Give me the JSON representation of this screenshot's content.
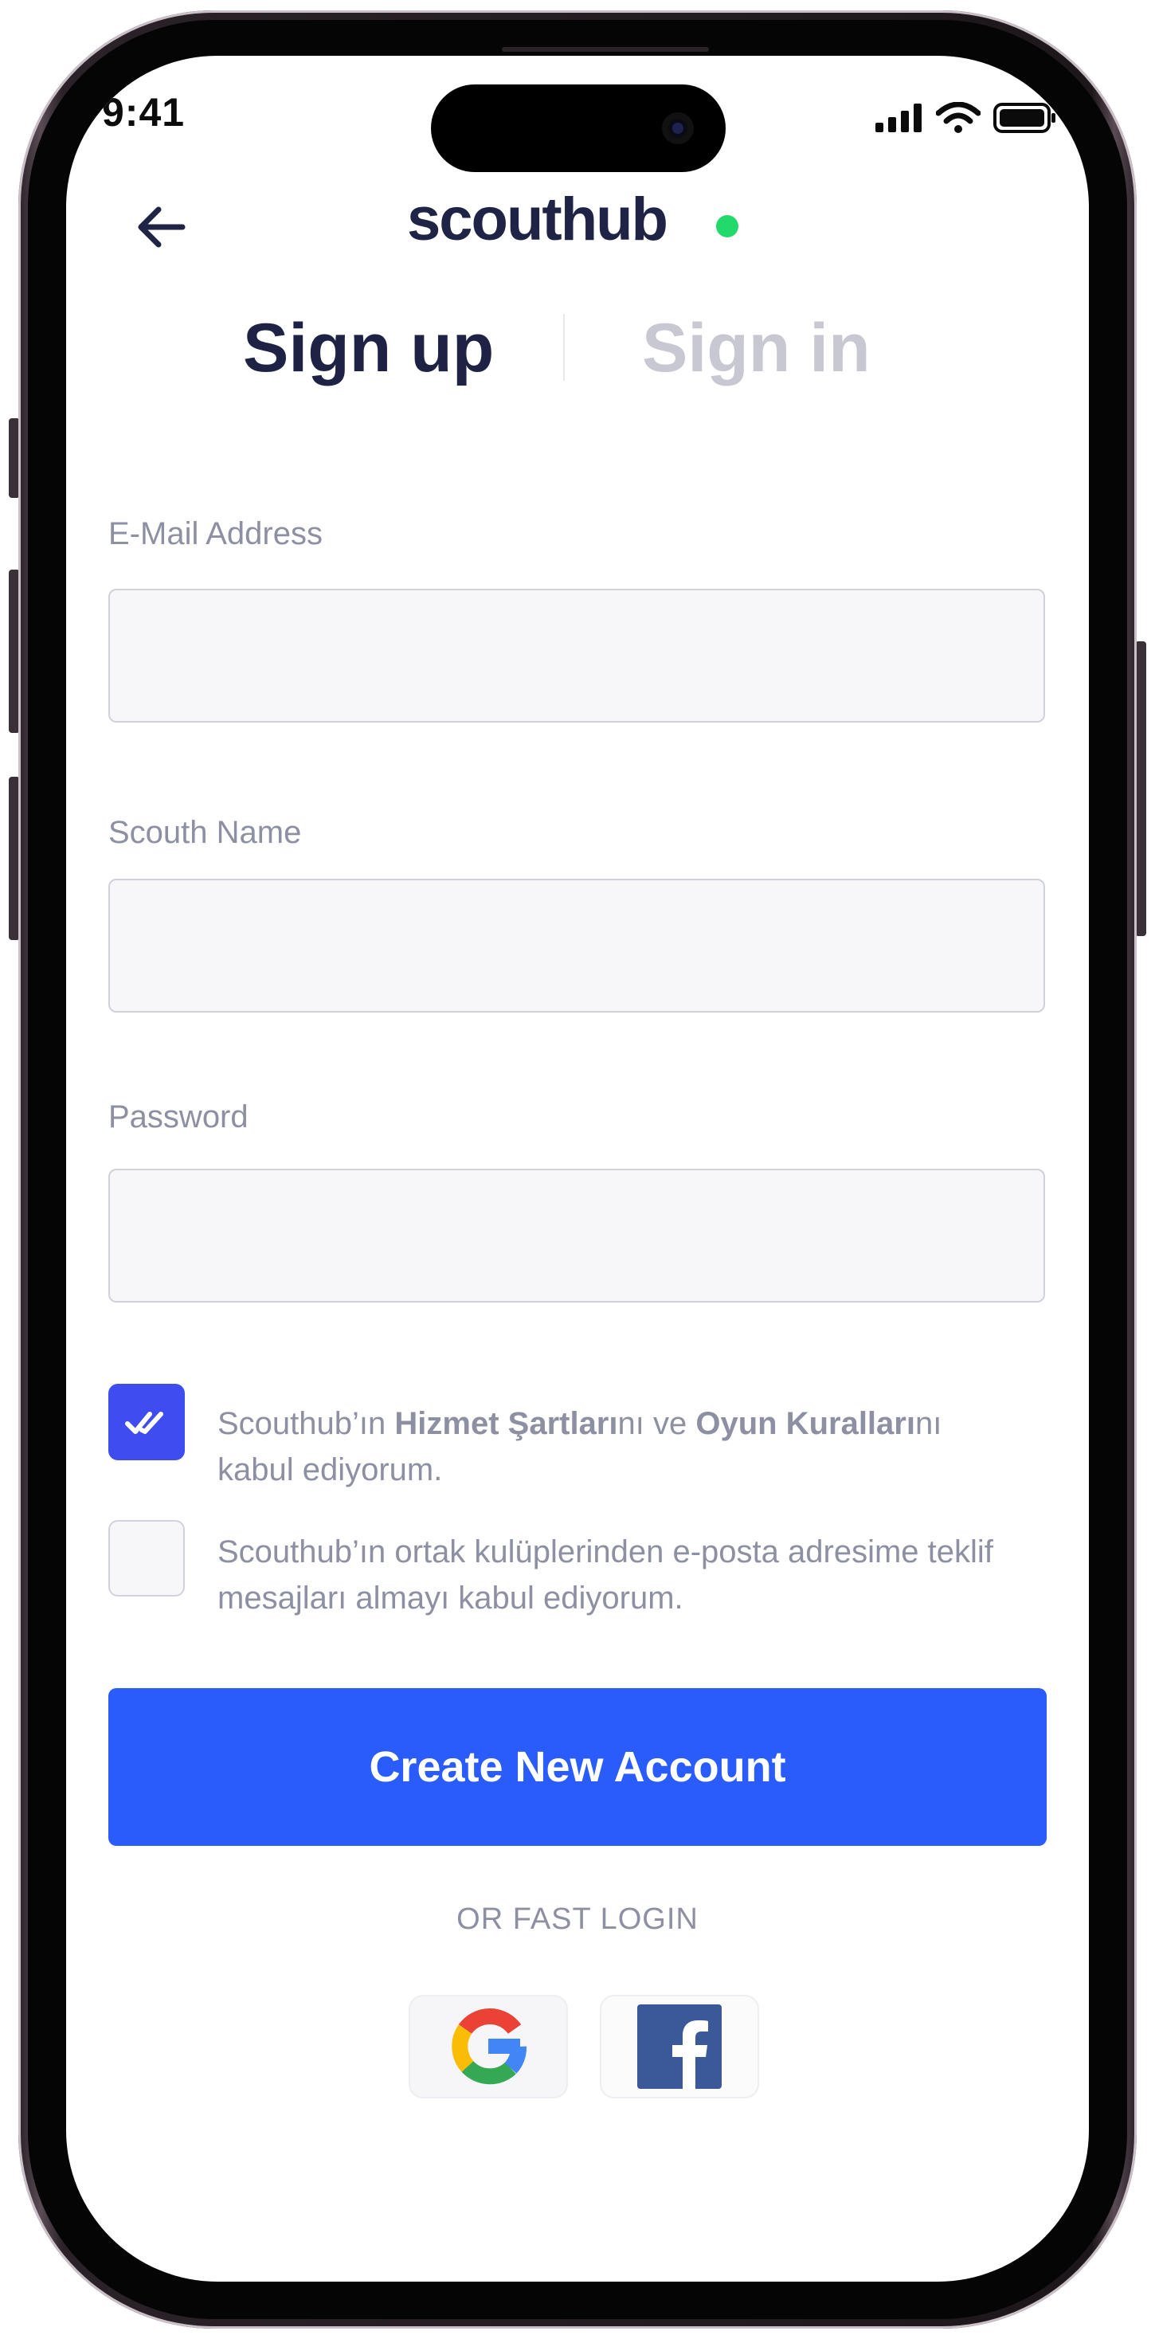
{
  "status_bar": {
    "time": "9:41"
  },
  "header": {
    "back_icon": "arrow-left-icon",
    "logo_text": "scouthub",
    "logo_dot_color": "#22d96b"
  },
  "tabs": [
    {
      "label": "Sign up",
      "active": true
    },
    {
      "label": "Sign in",
      "active": false
    }
  ],
  "form": {
    "email": {
      "label": "E-Mail Address",
      "value": ""
    },
    "scouth_name": {
      "label": "Scouth Name",
      "value": ""
    },
    "password": {
      "label": "Password",
      "value": ""
    }
  },
  "consents": [
    {
      "checked": true,
      "parts": [
        "Scouthub’ın ",
        "Hizmet Şartları",
        "nı ve ",
        "Oyun Kuralları",
        "nı kabul ediyorum."
      ]
    },
    {
      "checked": false,
      "text": "Scouthub’ın ortak kulüplerinden e-posta adresime teklif mesajları almayı kabul ediyorum."
    }
  ],
  "cta": {
    "label": "Create New Account",
    "color": "#2a5cfb"
  },
  "fast_login": {
    "label": "OR FAST LOGIN",
    "providers": [
      {
        "icon": "google-icon"
      },
      {
        "icon": "facebook-icon"
      }
    ]
  },
  "colors": {
    "primary": "#2a5cfb",
    "checkbox": "#3f4df0",
    "heading": "#1e2244",
    "muted": "#8d90a2"
  }
}
